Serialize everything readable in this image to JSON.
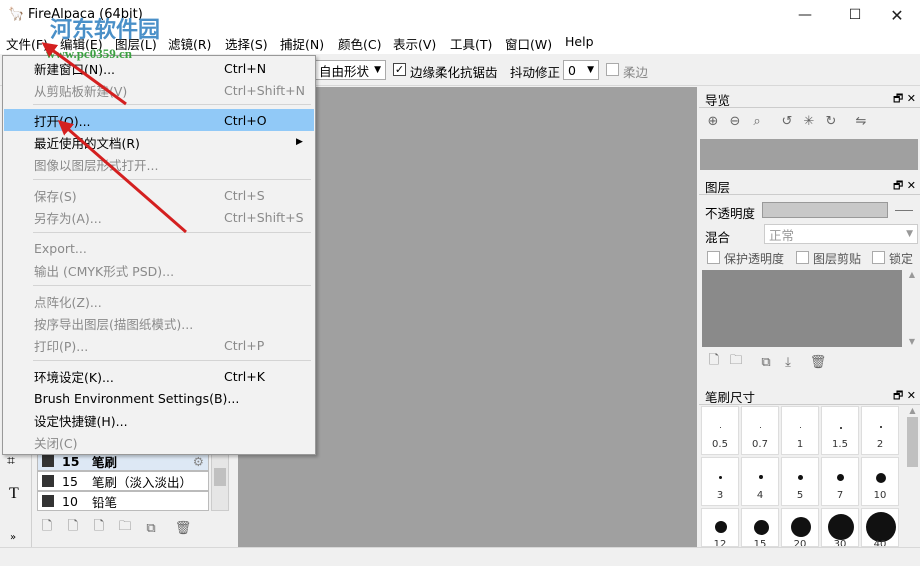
{
  "window": {
    "title": "FireAlpaca (64bit)"
  },
  "watermark": {
    "text": "河东软件园",
    "url": "www.pc0359.cn"
  },
  "menubar": {
    "items": [
      "文件(F)",
      "编辑(E)",
      "图层(L)",
      "滤镜(R)",
      "选择(S)",
      "捕捉(N)",
      "颜色(C)",
      "表示(V)",
      "工具(T)",
      "窗口(W)",
      "Help"
    ]
  },
  "toolbar": {
    "shape_select": "自由形状",
    "antialias_label": "边缘柔化抗锯齿",
    "stabilizer_label": "抖动修正",
    "stabilizer_value": "0",
    "soft_label": "柔边"
  },
  "file_menu": {
    "items": [
      {
        "label": "新建窗口(N)...",
        "shortcut": "Ctrl+N",
        "enabled": true
      },
      {
        "label": "从剪贴板新建(V)",
        "shortcut": "Ctrl+Shift+N",
        "enabled": false
      },
      {
        "label": "打开(O)...",
        "shortcut": "Ctrl+O",
        "enabled": true,
        "highlighted": true
      },
      {
        "label": "最近使用的文档(R)",
        "shortcut": "",
        "enabled": true,
        "submenu": true
      },
      {
        "label": "图像以图层形式打开...",
        "shortcut": "",
        "enabled": false
      },
      {
        "label": "保存(S)",
        "shortcut": "Ctrl+S",
        "enabled": false
      },
      {
        "label": "另存为(A)...",
        "shortcut": "Ctrl+Shift+S",
        "enabled": false
      },
      {
        "label": "Export...",
        "shortcut": "",
        "enabled": false
      },
      {
        "label": "输出 (CMYK形式 PSD)...",
        "shortcut": "",
        "enabled": false
      },
      {
        "label": "点阵化(Z)...",
        "shortcut": "",
        "enabled": false
      },
      {
        "label": "按序导出图层(描图纸模式)...",
        "shortcut": "",
        "enabled": false
      },
      {
        "label": "打印(P)...",
        "shortcut": "Ctrl+P",
        "enabled": false
      },
      {
        "label": "环境设定(K)...",
        "shortcut": "Ctrl+K",
        "enabled": true
      },
      {
        "label": "Brush Environment Settings(B)...",
        "shortcut": "",
        "enabled": true
      },
      {
        "label": "设定快捷键(H)...",
        "shortcut": "",
        "enabled": true
      },
      {
        "label": "关闭(C)",
        "shortcut": "",
        "enabled": false
      }
    ]
  },
  "navigator_panel": {
    "title": "导览"
  },
  "layer_panel": {
    "title": "图层",
    "opacity_label": "不透明度",
    "blend_label": "混合",
    "blend_value": "正常",
    "protect_alpha": "保护透明度",
    "clipping": "图层剪贴",
    "lock": "锁定"
  },
  "brush_size_panel": {
    "title": "笔刷尺寸",
    "sizes": [
      "0.5",
      "0.7",
      "1",
      "1.5",
      "2",
      "3",
      "4",
      "5",
      "7",
      "10",
      "12",
      "15",
      "20",
      "30",
      "40"
    ]
  },
  "brush_list": {
    "items": [
      {
        "size": "15",
        "name": "笔刷"
      },
      {
        "size": "15",
        "name": "笔刷（淡入淡出）"
      },
      {
        "size": "10",
        "name": "铅笔"
      }
    ]
  },
  "colors": {
    "highlight": "#91c9f7",
    "canvas": "#a0a0a0",
    "arrow": "#d42020"
  }
}
